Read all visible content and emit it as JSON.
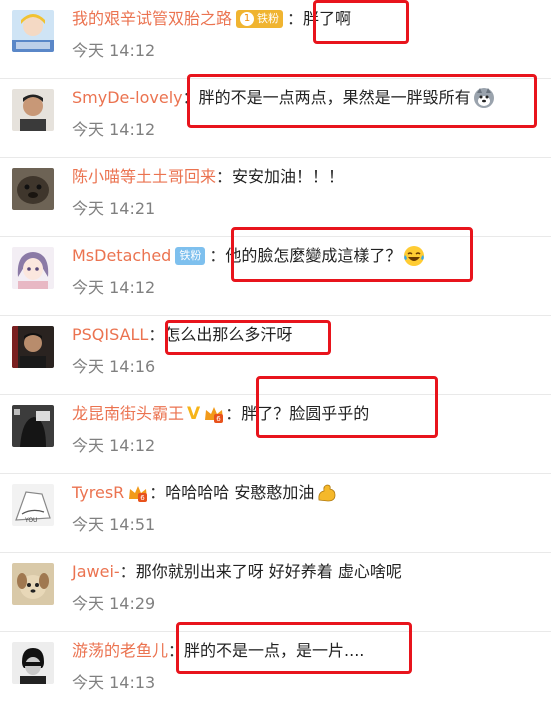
{
  "comments": [
    {
      "username": "我的艰辛试管双胎之路",
      "badge": {
        "type": "gold",
        "level": "1",
        "label": "铁粉"
      },
      "separator": "：",
      "text": "胖了啊",
      "time": "今天 14:12",
      "avatar": "cartoon-girl-avatar"
    },
    {
      "username": "SmyDe-lovely",
      "separator": "：",
      "text": "胖的不是一点两点，果然是一胖毁所有",
      "emoji": "husky-emoji",
      "time": "今天 14:12",
      "avatar": "man-portrait-avatar"
    },
    {
      "username": "陈小喵等土土哥回来",
      "separator": "：",
      "text": "安安加油！！！",
      "time": "今天 14:21",
      "avatar": "sea-otter-avatar"
    },
    {
      "username": "MsDetached",
      "badge": {
        "type": "blue",
        "label": "铁粉"
      },
      "separator": "：",
      "text": "他的臉怎麼變成這樣了？",
      "emoji": "laugh-cry-emoji",
      "time": "今天 14:12",
      "avatar": "anime-girl-avatar"
    },
    {
      "username": "PSQISALL",
      "separator": "：",
      "text": "怎么出那么多汗呀",
      "time": "今天 14:16",
      "avatar": "man-dark-avatar"
    },
    {
      "username": "龙昆南街头霸王",
      "vip": true,
      "separator": "：",
      "text": "胖了？脸圆乎乎的",
      "time": "今天 14:12",
      "avatar": "bw-photo-avatar"
    },
    {
      "username": "TyresR",
      "vip_small": true,
      "separator": "：",
      "text": "哈哈哈哈 安憨憨加油",
      "emoji": "flex-arm-emoji",
      "time": "今天 14:51",
      "avatar": "sketch-avatar"
    },
    {
      "username": "Jawei-",
      "separator": "：",
      "text": "那你就别出来了呀 好好养着 虚心啥呢",
      "time": "今天 14:29",
      "avatar": "puppy-avatar"
    },
    {
      "username": "游荡的老鱼儿",
      "separator": "：",
      "text": "胖的不是一点，是一片....",
      "time": "今天 14:13",
      "avatar": "bw-portrait-avatar"
    }
  ],
  "colors": {
    "username": "#eb7350",
    "time": "#808080",
    "highlight": "#e8141c"
  }
}
